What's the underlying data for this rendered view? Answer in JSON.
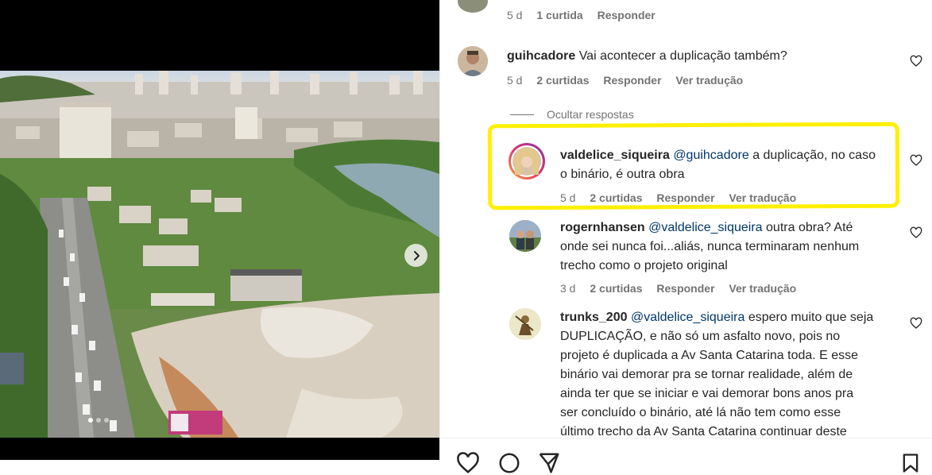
{
  "post_image": {
    "alt_icon": "chevron-right-icon",
    "carousel_dots": 3,
    "active_dot": 1
  },
  "comments": {
    "top_partial": {
      "time": "5 d",
      "likes": "1 curtida",
      "reply": "Responder"
    },
    "main": {
      "username": "guihcadore",
      "text": "Vai acontecer a duplicação também?",
      "time": "5 d",
      "likes": "2 curtidas",
      "reply": "Responder",
      "translate": "Ver tradução"
    },
    "hide_replies": "Ocultar respostas",
    "replies": [
      {
        "username": "valdelice_siqueira",
        "mention": "@guihcadore",
        "text_line1": "a duplicação, no caso",
        "text_line2": "o binário, é outra obra",
        "time": "5 d",
        "likes": "2 curtidas",
        "reply": "Responder",
        "translate": "Ver tradução"
      },
      {
        "username": "rogernhansen",
        "mention": "@valdelice_siqueira",
        "text_line1": "outra obra? Até",
        "text_line2": "onde sei nunca foi...aliás, nunca terminaram nenhum",
        "text_line3": "trecho como o projeto original",
        "time": "3 d",
        "likes": "2 curtidas",
        "reply": "Responder",
        "translate": "Ver tradução"
      },
      {
        "username": "trunks_200",
        "mention": "@valdelice_siqueira",
        "text_line1": "espero muito que seja",
        "text_line2": "DUPLICAÇÃO, e não só um asfalto novo, pois no",
        "text_line3": "projeto é duplicada a Av Santa Catarina toda. E esse",
        "text_line4": "binário vai demorar pra se tornar realidade, além de",
        "text_line5": "ainda ter que se iniciar e vai demorar bons anos pra",
        "text_line6": "ser concluído o binário, até lá não tem como esse",
        "text_line7": "último trecho da Av Santa Catarina continuar deste"
      }
    ]
  },
  "colors": {
    "highlight": "#ffef00",
    "mention": "#00376b",
    "meta": "#737373"
  }
}
